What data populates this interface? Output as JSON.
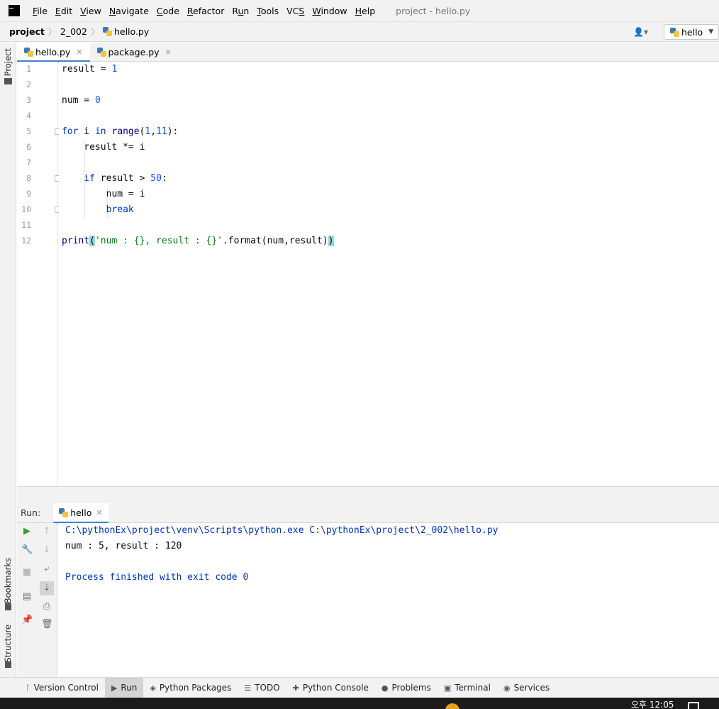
{
  "menubar": {
    "logo": "PC",
    "items": [
      {
        "mnemonic": "F",
        "rest": "ile"
      },
      {
        "mnemonic": "E",
        "rest": "dit"
      },
      {
        "mnemonic": "V",
        "rest": "iew"
      },
      {
        "mnemonic": "N",
        "rest": "avigate"
      },
      {
        "mnemonic": "C",
        "rest": "ode"
      },
      {
        "mnemonic": "R",
        "rest": "efactor"
      },
      {
        "mnemonic": "R",
        "rest": "un",
        "pre": ""
      },
      {
        "mnemonic": "T",
        "rest": "ools"
      },
      {
        "mnemonic": "",
        "rest": "VCS"
      },
      {
        "mnemonic": "W",
        "rest": "indow"
      },
      {
        "mnemonic": "H",
        "rest": "elp"
      }
    ],
    "window_title": "project - hello.py"
  },
  "navbar": {
    "project": "project",
    "folder": "2_002",
    "file": "hello.py",
    "run_config": "hello"
  },
  "left_strip": {
    "project": "Project",
    "bookmarks": "Bookmarks",
    "structure": "Structure"
  },
  "tabs": [
    {
      "label": "hello.py",
      "active": true
    },
    {
      "label": "package.py",
      "active": false
    }
  ],
  "editor": {
    "line_numbers": [
      "1",
      "2",
      "3",
      "4",
      "5",
      "6",
      "7",
      "8",
      "9",
      "10",
      "11",
      "12"
    ],
    "current_line": 12
  },
  "run_panel": {
    "label": "Run:",
    "tab": "hello",
    "output": [
      {
        "text": "C:\\pythonEx\\project\\venv\\Scripts\\python.exe C:\\pythonEx\\project\\2_002\\hello.py",
        "color": "#0033b3"
      },
      {
        "text": "num : 5, result : 120",
        "color": "#080808"
      },
      {
        "text": "",
        "color": "#080808"
      },
      {
        "text": "Process finished with exit code 0",
        "color": "#0033b3"
      }
    ]
  },
  "bottombar": [
    {
      "label": "Version Control",
      "icon": "branch-icon"
    },
    {
      "label": "Run",
      "icon": "play-icon",
      "active": true
    },
    {
      "label": "Python Packages",
      "icon": "layers-icon"
    },
    {
      "label": "TODO",
      "icon": "list-icon"
    },
    {
      "label": "Python Console",
      "icon": "python-console-icon"
    },
    {
      "label": "Problems",
      "icon": "info-icon"
    },
    {
      "label": "Terminal",
      "icon": "terminal-icon"
    },
    {
      "label": "Services",
      "icon": "services-icon"
    }
  ],
  "taskbar": {
    "clock": "오후 12:05"
  },
  "colors": {
    "keyword": "#0033b3",
    "number": "#1750eb",
    "string": "#067d17",
    "accent": "#4083c9",
    "current_line": "#fffae3"
  }
}
